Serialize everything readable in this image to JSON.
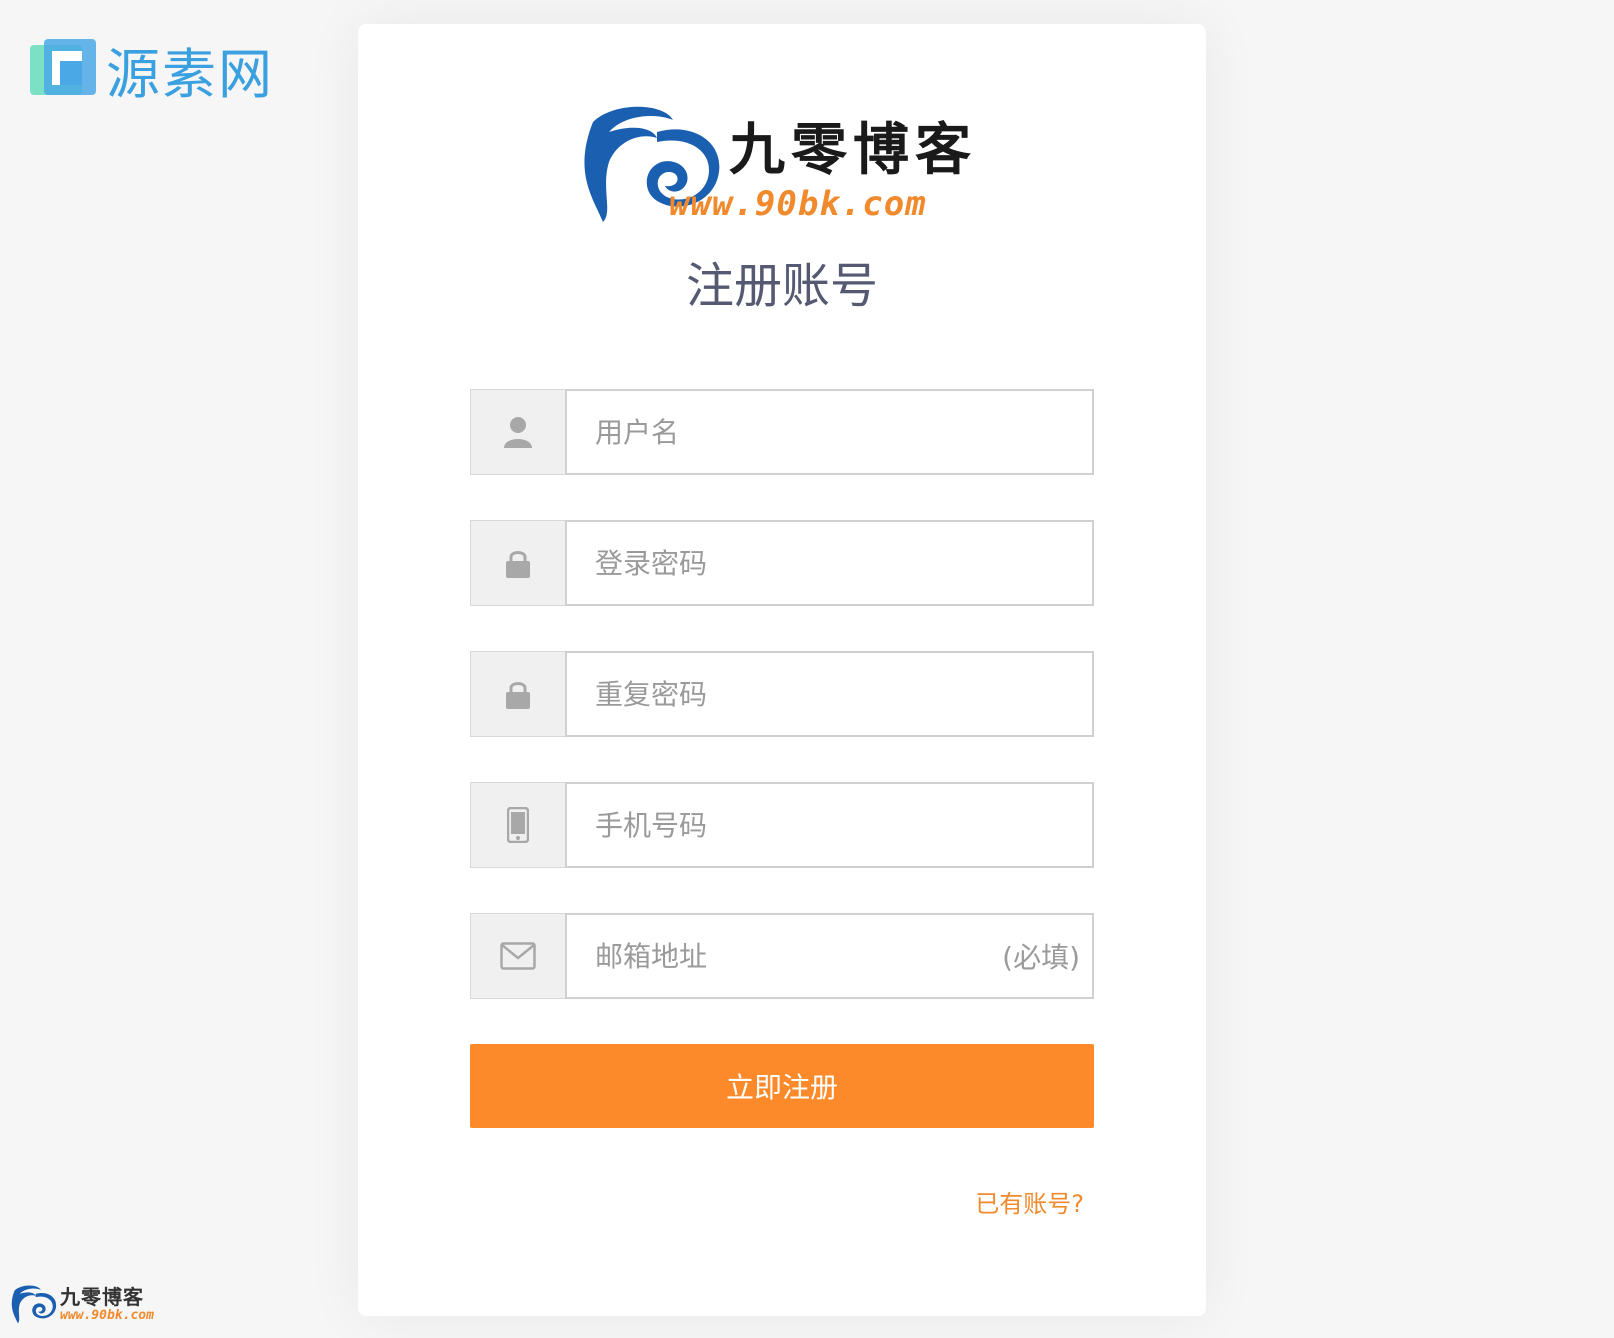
{
  "brand": {
    "name": "源素网"
  },
  "watermark": {
    "title": "九零博客",
    "url": "www.90bk.com"
  },
  "card": {
    "logo": {
      "title": "九零博客",
      "url": "www.90bk.com"
    },
    "title": "注册账号",
    "fields": [
      {
        "icon": "user-icon",
        "placeholder": "用户名",
        "note": ""
      },
      {
        "icon": "lock-icon",
        "placeholder": "登录密码",
        "note": ""
      },
      {
        "icon": "lock-icon",
        "placeholder": "重复密码",
        "note": ""
      },
      {
        "icon": "mobile-phone-icon",
        "placeholder": "手机号码",
        "note": ""
      },
      {
        "icon": "envelope-icon",
        "placeholder": "邮箱地址",
        "note": "(必填)"
      }
    ],
    "submit_label": "立即注册",
    "login_link": "已有账号?"
  },
  "colors": {
    "accent": "#fc8a2a",
    "brand_blue": "#3aa0e0",
    "logo_blue": "#1b5fb0",
    "title_color": "#555a72"
  }
}
